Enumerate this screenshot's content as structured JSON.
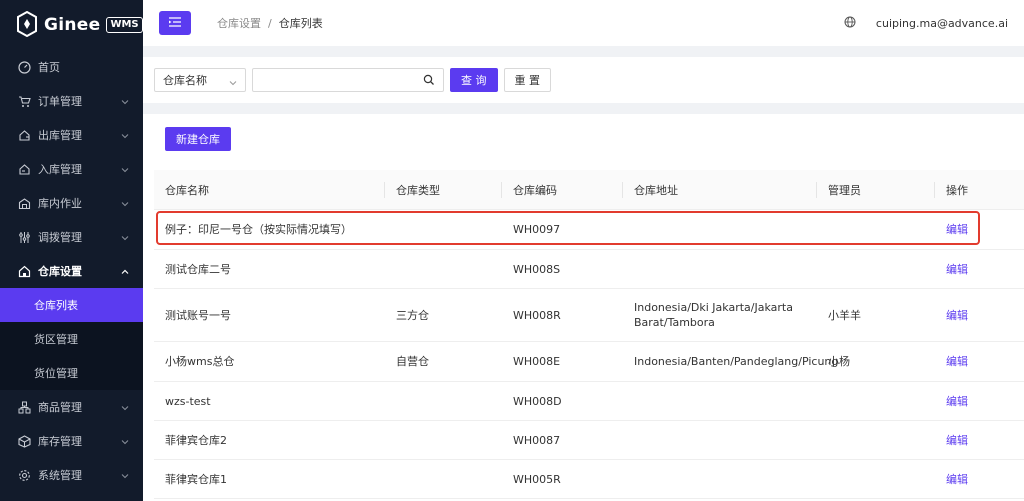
{
  "app": {
    "brand": "Ginee",
    "badge": "WMS"
  },
  "sidebar": {
    "items": [
      {
        "label": "首页",
        "icon": "dashboard-icon",
        "has_children": false
      },
      {
        "label": "订单管理",
        "icon": "cart-icon",
        "has_children": true
      },
      {
        "label": "出库管理",
        "icon": "outbound-icon",
        "has_children": true
      },
      {
        "label": "入库管理",
        "icon": "inbound-icon",
        "has_children": true
      },
      {
        "label": "库内作业",
        "icon": "warehouse-ops-icon",
        "has_children": true
      },
      {
        "label": "调拨管理",
        "icon": "transfer-icon",
        "has_children": true
      },
      {
        "label": "仓库设置",
        "icon": "home-icon",
        "has_children": true,
        "open": true
      },
      {
        "label": "商品管理",
        "icon": "product-icon",
        "has_children": true
      },
      {
        "label": "库存管理",
        "icon": "inventory-icon",
        "has_children": true
      },
      {
        "label": "系统管理",
        "icon": "gear-icon",
        "has_children": true
      }
    ],
    "submenu": [
      {
        "label": "仓库列表",
        "active": true
      },
      {
        "label": "货区管理",
        "active": false
      },
      {
        "label": "货位管理",
        "active": false
      }
    ]
  },
  "header": {
    "breadcrumb": [
      "仓库设置",
      "仓库列表"
    ],
    "breadcrumb_sep": "/",
    "user_email": "cuiping.ma@advance.ai"
  },
  "search": {
    "field_select": "仓库名称",
    "input_value": "",
    "query_label": "查 询",
    "reset_label": "重 置"
  },
  "toolbar": {
    "new_label": "新建仓库"
  },
  "table": {
    "columns": [
      "仓库名称",
      "仓库类型",
      "仓库编码",
      "仓库地址",
      "管理员",
      "操作"
    ],
    "rows": [
      {
        "name": "例子：印尼一号仓（按实际情况填写）",
        "type": "",
        "code": "WH0097",
        "address": "",
        "admin": "",
        "action": "编辑"
      },
      {
        "name": "测试仓库二号",
        "type": "",
        "code": "WH008S",
        "address": "",
        "admin": "",
        "action": "编辑"
      },
      {
        "name": "测试账号一号",
        "type": "三方仓",
        "code": "WH008R",
        "address": "Indonesia/Dki Jakarta/Jakarta Barat/Tambora",
        "admin": "小羊羊",
        "action": "编辑"
      },
      {
        "name": "小杨wms总仓",
        "type": "自营仓",
        "code": "WH008E",
        "address": "Indonesia/Banten/Pandeglang/Picung",
        "admin": "小杨",
        "action": "编辑"
      },
      {
        "name": "wzs-test",
        "type": "",
        "code": "WH008D",
        "address": "",
        "admin": "",
        "action": "编辑"
      },
      {
        "name": "菲律宾仓库2",
        "type": "",
        "code": "WH0087",
        "address": "",
        "admin": "",
        "action": "编辑"
      },
      {
        "name": "菲律宾仓库1",
        "type": "",
        "code": "WH005R",
        "address": "",
        "admin": "",
        "action": "编辑"
      }
    ]
  },
  "colors": {
    "accent": "#5b3bf0",
    "sidebar_bg": "#121b2b",
    "highlight": "#e23b2e"
  }
}
